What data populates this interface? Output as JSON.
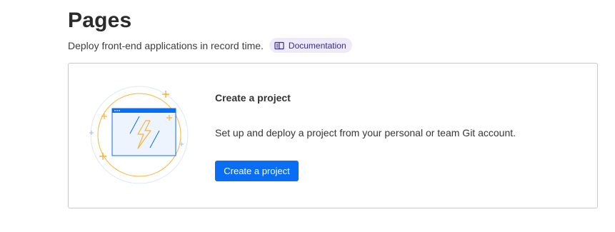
{
  "header": {
    "title": "Pages",
    "subtitle": "Deploy front-end applications in record time.",
    "doc_link_label": "Documentation"
  },
  "project_card": {
    "title": "Create a project",
    "description": "Set up and deploy a project from your personal or team Git account.",
    "button_label": "Create a project"
  },
  "icons": {
    "doc_badge": "book-icon",
    "illustration": "browser-window-lightning-icon"
  },
  "colors": {
    "accent": "#0a6ef5",
    "badge_bg": "#eeeaf9",
    "badge_text": "#3a2f84",
    "illustration_orange": "#f6b43c"
  }
}
